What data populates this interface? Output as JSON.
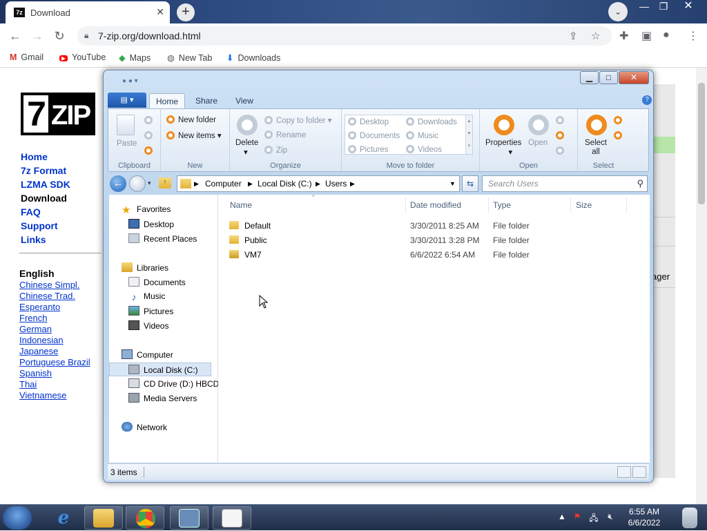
{
  "browser": {
    "tab_title": "Download",
    "tab_favicon": "7z",
    "url": "7-zip.org/download.html",
    "bookmarks": [
      "Gmail",
      "YouTube",
      "Maps",
      "New Tab",
      "Downloads"
    ]
  },
  "page": {
    "logo_box": "7",
    "logo_text": "ZIP",
    "nav": [
      "Home",
      "7z Format",
      "LZMA SDK",
      "Download",
      "FAQ",
      "Support",
      "Links"
    ],
    "lang_heading": "English",
    "languages": [
      "Chinese Simpl.",
      "Chinese Trad.",
      "Esperanto",
      "French",
      "German",
      "Indonesian",
      "Japanese",
      "Portuguese Brazil",
      "Spanish",
      "Thai",
      "Vietnamese"
    ],
    "right_fragment": "ager"
  },
  "explorer": {
    "tabs": [
      "Home",
      "Share",
      "View"
    ],
    "ribbon": {
      "clipboard": {
        "paste": "Paste",
        "label": "Clipboard"
      },
      "new": {
        "new_folder": "New folder",
        "new_items": "New items",
        "label": "New"
      },
      "organize": {
        "delete": "Delete",
        "copy_to": "Copy to folder",
        "rename": "Rename",
        "zip": "Zip",
        "label": "Organize"
      },
      "move": {
        "items": [
          "Desktop",
          "Downloads",
          "Documents",
          "Music",
          "Pictures",
          "Videos"
        ],
        "label": "Move to folder"
      },
      "open": {
        "properties": "Properties",
        "open": "Open",
        "label": "Open"
      },
      "select": {
        "select_all": "Select\nall",
        "select_all_1": "Select",
        "select_all_2": "all",
        "label": "Select"
      }
    },
    "breadcrumb": [
      "Computer",
      "Local Disk (C:)",
      "Users"
    ],
    "search_placeholder": "Search Users",
    "nav": {
      "favorites": "Favorites",
      "desktop": "Desktop",
      "recent": "Recent Places",
      "libraries": "Libraries",
      "documents": "Documents",
      "music": "Music",
      "pictures": "Pictures",
      "videos": "Videos",
      "computer": "Computer",
      "localdisk": "Local Disk (C:)",
      "cddrive": "CD Drive (D:) HBCD_",
      "media": "Media Servers",
      "network": "Network"
    },
    "columns": {
      "name": "Name",
      "date": "Date modified",
      "type": "Type",
      "size": "Size"
    },
    "files": [
      {
        "name": "Default",
        "date": "3/30/2011 8:25 AM",
        "type": "File folder"
      },
      {
        "name": "Public",
        "date": "3/30/2011 3:28 PM",
        "type": "File folder"
      },
      {
        "name": "VM7",
        "date": "6/6/2022 6:54 AM",
        "type": "File folder"
      }
    ],
    "status": "3 items"
  },
  "taskbar": {
    "time": "6:55 AM",
    "date": "6/6/2022"
  }
}
